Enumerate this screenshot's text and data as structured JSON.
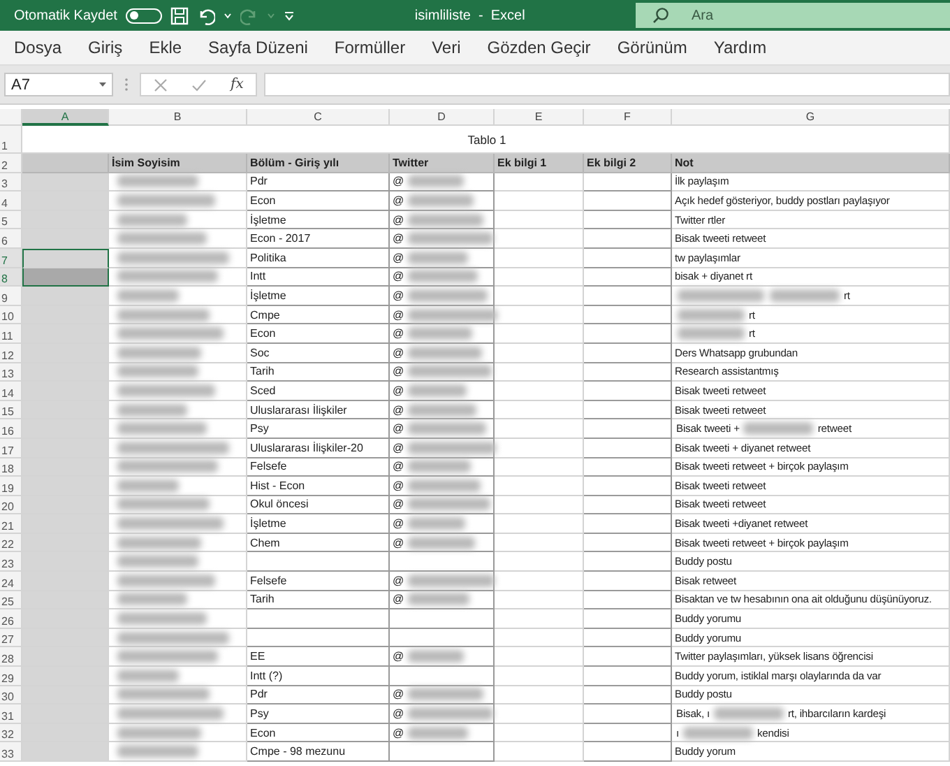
{
  "title_bar": {
    "autosave_label": "Otomatik Kaydet",
    "autosave_on": false,
    "title": "isimliliste  -  Excel",
    "search": {
      "placeholder": "Ara"
    },
    "redo_disabled": true
  },
  "menu": [
    {
      "label": "Dosya"
    },
    {
      "label": "Giriş"
    },
    {
      "label": "Ekle"
    },
    {
      "label": "Sayfa Düzeni"
    },
    {
      "label": "Formüller"
    },
    {
      "label": "Veri"
    },
    {
      "label": "Gözden Geçir"
    },
    {
      "label": "Görünüm"
    },
    {
      "label": "Yardım"
    }
  ],
  "formula_bar": {
    "name_box": "A7",
    "fx": "fx"
  },
  "sheet": {
    "columns": [
      {
        "label": "A",
        "selected": true
      },
      {
        "label": "B",
        "selected": false
      },
      {
        "label": "C",
        "selected": false
      },
      {
        "label": "D",
        "selected": false
      },
      {
        "label": "E",
        "selected": false
      },
      {
        "label": "F",
        "selected": false
      },
      {
        "label": "G",
        "selected": false
      }
    ],
    "title_row": {
      "num": "1",
      "text": "Tablo 1"
    },
    "header_row": {
      "num": "2",
      "cells": [
        "İsim Soyisim",
        "Bölüm - Giriş yılı",
        "Twitter",
        "Ek bilgi 1",
        "Ek bilgi 2",
        "Not"
      ]
    },
    "rows": [
      {
        "num": "3",
        "selected": false,
        "shaded": false,
        "name_hidden": true,
        "dept": "Pdr",
        "twitter": "@",
        "handle_hidden": true,
        "note": "İlk paylaşım"
      },
      {
        "num": "4",
        "selected": false,
        "shaded": false,
        "name_hidden": true,
        "dept": "Econ",
        "twitter": "@",
        "handle_hidden": true,
        "note": "Açık hedef gösteriyor, buddy postları paylaşıyor"
      },
      {
        "num": "5",
        "selected": false,
        "shaded": false,
        "name_hidden": true,
        "dept": "İşletme",
        "twitter": "@",
        "handle_hidden": true,
        "note": "Twitter rtler"
      },
      {
        "num": "6",
        "selected": false,
        "shaded": false,
        "name_hidden": true,
        "dept": "Econ - 2017",
        "twitter": "@",
        "handle_hidden": true,
        "note": "Bisak tweeti retweet"
      },
      {
        "num": "7",
        "selected": true,
        "shaded": false,
        "name_hidden": true,
        "dept": "Politika",
        "twitter": "@",
        "handle_hidden": true,
        "note": "tw paylaşımlar"
      },
      {
        "num": "8",
        "selected": true,
        "shaded": true,
        "name_hidden": true,
        "dept": "Intt",
        "twitter": "@",
        "handle_hidden": true,
        "note": "bisak + diyanet rt"
      },
      {
        "num": "9",
        "selected": false,
        "shaded": false,
        "name_hidden": true,
        "dept": "İşletme",
        "twitter": "@",
        "handle_hidden": true,
        "note": [
          {
            "kind": "redacted"
          },
          {
            "kind": "redacted"
          },
          {
            "kind": "text",
            "text": "rt"
          }
        ]
      },
      {
        "num": "10",
        "selected": false,
        "shaded": false,
        "name_hidden": true,
        "dept": "Cmpe",
        "twitter": "@",
        "handle_hidden": true,
        "note": [
          {
            "kind": "redacted"
          },
          {
            "kind": "text",
            "text": "rt"
          }
        ]
      },
      {
        "num": "11",
        "selected": false,
        "shaded": false,
        "name_hidden": true,
        "dept": "Econ",
        "twitter": "@",
        "handle_hidden": true,
        "note": [
          {
            "kind": "redacted"
          },
          {
            "kind": "text",
            "text": "rt"
          }
        ]
      },
      {
        "num": "12",
        "selected": false,
        "shaded": false,
        "name_hidden": true,
        "dept": "Soc",
        "twitter": "@",
        "handle_hidden": true,
        "note": "Ders Whatsapp grubundan"
      },
      {
        "num": "13",
        "selected": false,
        "shaded": false,
        "name_hidden": true,
        "dept": "Tarih",
        "twitter": "@",
        "handle_hidden": true,
        "note": "Research assistantmış"
      },
      {
        "num": "14",
        "selected": false,
        "shaded": false,
        "name_hidden": true,
        "dept": "Sced",
        "twitter": "@",
        "handle_hidden": true,
        "note": "Bisak tweeti retweet"
      },
      {
        "num": "15",
        "selected": false,
        "shaded": false,
        "name_hidden": true,
        "dept": "Uluslararası İlişkiler",
        "twitter": "@",
        "handle_hidden": true,
        "note": "Bisak tweeti retweet"
      },
      {
        "num": "16",
        "selected": false,
        "shaded": false,
        "name_hidden": true,
        "dept": "Psy",
        "twitter": "@",
        "handle_hidden": true,
        "note": [
          {
            "kind": "text",
            "text": "Bisak tweeti +"
          },
          {
            "kind": "redacted"
          },
          {
            "kind": "text",
            "text": "retweet"
          }
        ]
      },
      {
        "num": "17",
        "selected": false,
        "shaded": false,
        "name_hidden": true,
        "dept": "Uluslararası İlişkiler-20",
        "twitter": "@",
        "handle_hidden": true,
        "note": "Bisak tweeti + diyanet retweet"
      },
      {
        "num": "18",
        "selected": false,
        "shaded": false,
        "name_hidden": true,
        "dept": "Felsefe",
        "twitter": "@",
        "handle_hidden": true,
        "note": "Bisak tweeti retweet + birçok paylaşım"
      },
      {
        "num": "19",
        "selected": false,
        "shaded": false,
        "name_hidden": true,
        "dept": "Hist - Econ",
        "twitter": "@",
        "handle_hidden": true,
        "note": "Bisak tweeti retweet"
      },
      {
        "num": "20",
        "selected": false,
        "shaded": false,
        "name_hidden": true,
        "dept": "Okul öncesi",
        "twitter": "@",
        "handle_hidden": true,
        "note": "Bisak tweeti retweet"
      },
      {
        "num": "21",
        "selected": false,
        "shaded": false,
        "name_hidden": true,
        "dept": "İşletme",
        "twitter": "@",
        "handle_hidden": true,
        "note": "Bisak tweeti +diyanet retweet"
      },
      {
        "num": "22",
        "selected": false,
        "shaded": false,
        "name_hidden": true,
        "dept": "Chem",
        "twitter": "@",
        "handle_hidden": true,
        "note": "Bisak tweeti retweet + birçok paylaşım"
      },
      {
        "num": "23",
        "selected": false,
        "shaded": false,
        "name_hidden": true,
        "note": "Buddy postu"
      },
      {
        "num": "24",
        "selected": false,
        "shaded": false,
        "name_hidden": true,
        "dept": "Felsefe",
        "twitter": "@",
        "handle_hidden": true,
        "note": "Bisak retweet"
      },
      {
        "num": "25",
        "selected": false,
        "shaded": false,
        "name_hidden": true,
        "dept": "Tarih",
        "twitter": "@",
        "handle_hidden": true,
        "note": "Bisaktan ve tw hesabının ona ait olduğunu düşünüyoruz."
      },
      {
        "num": "26",
        "selected": false,
        "shaded": false,
        "name_hidden": true,
        "note": "Buddy yorumu"
      },
      {
        "num": "27",
        "selected": false,
        "shaded": false,
        "name_hidden": true,
        "note": "Buddy yorumu"
      },
      {
        "num": "28",
        "selected": false,
        "shaded": false,
        "name_hidden": true,
        "dept": "EE",
        "twitter": "@",
        "handle_hidden": true,
        "note": "Twitter paylaşımları, yüksek lisans öğrencisi"
      },
      {
        "num": "29",
        "selected": false,
        "shaded": false,
        "name_hidden": true,
        "dept": "Intt (?)",
        "note": "Buddy yorum, istiklal marşı olaylarında da var"
      },
      {
        "num": "30",
        "selected": false,
        "shaded": false,
        "name_hidden": true,
        "dept": "Pdr",
        "twitter": "@",
        "handle_hidden": true,
        "note": "Buddy postu"
      },
      {
        "num": "31",
        "selected": false,
        "shaded": false,
        "name_hidden": true,
        "dept": "Psy",
        "twitter": "@",
        "handle_hidden": true,
        "note": [
          {
            "kind": "text",
            "text": "Bisak, ı"
          },
          {
            "kind": "redacted"
          },
          {
            "kind": "text",
            "text": "rt, ihbarcıların kardeşi"
          }
        ]
      },
      {
        "num": "32",
        "selected": false,
        "shaded": false,
        "name_hidden": true,
        "dept": "Econ",
        "twitter": "@",
        "handle_hidden": true,
        "note": [
          {
            "kind": "text",
            "text": "ı"
          },
          {
            "kind": "redacted"
          },
          {
            "kind": "text",
            "text": "kendisi"
          }
        ]
      },
      {
        "num": "33",
        "selected": false,
        "shaded": false,
        "name_hidden": true,
        "dept": "Cmpe - 98 mezunu",
        "note": "Buddy yorum"
      }
    ]
  }
}
